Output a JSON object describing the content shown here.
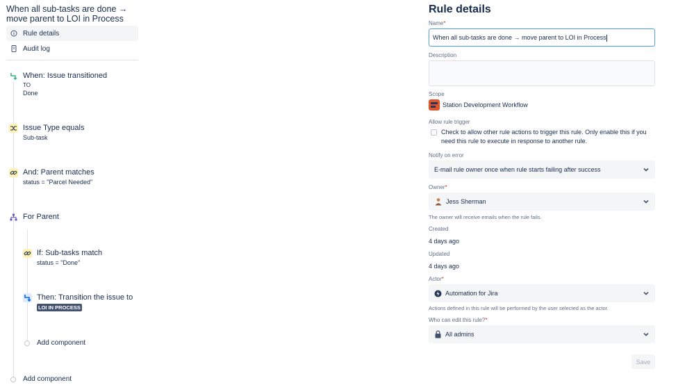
{
  "rule": {
    "title": "When all sub-tasks are done → move parent to LOI in Process"
  },
  "nav": {
    "items": [
      {
        "label": "Rule details",
        "icon": "info-icon"
      },
      {
        "label": "Audit log",
        "icon": "document-icon"
      }
    ]
  },
  "components": {
    "trigger": {
      "title": "When: Issue transitioned",
      "line1": "TO",
      "line2": "Done",
      "icon": "transition-icon",
      "color": "#36b37e"
    },
    "condition1": {
      "title": "Issue Type equals",
      "sub": "Sub-task",
      "icon": "shuffle-icon",
      "color": "#ffc400"
    },
    "condition2": {
      "title": "And: Parent matches",
      "sub": "status = \"Parcel Needed\"",
      "icon": "link-icon",
      "color": "#ffc400"
    },
    "branch": {
      "title": "For Parent",
      "icon": "branch-icon",
      "color": "#6554c0"
    },
    "branch_condition": {
      "title": "If: Sub-tasks match",
      "sub": "status = \"Done\"",
      "icon": "link-icon",
      "color": "#ffc400"
    },
    "action": {
      "title": "Then: Transition the issue to",
      "status_lozenge": "LOI IN PROCESS",
      "icon": "transition-icon",
      "color": "#0065ff"
    },
    "add_inner": "Add component",
    "add_outer": "Add component"
  },
  "details": {
    "heading": "Rule details",
    "name_label": "Name",
    "name_value": "When all sub-tasks are done → move parent to LOI in Process",
    "description_label": "Description",
    "description_value": "",
    "scope_label": "Scope",
    "scope_value": "Station Development Workflow",
    "allow_trigger_label": "Allow rule trigger",
    "allow_trigger_text": "Check to allow other rule actions to trigger this rule. Only enable this if you need this rule to execute in response to another rule.",
    "allow_trigger_checked": false,
    "notify_label": "Notify on error",
    "notify_value": "E-mail rule owner once when rule starts failing after success",
    "owner_label": "Owner",
    "owner_value": "Jess Sherman",
    "owner_help": "The owner will receive emails when the rule fails.",
    "created_label": "Created",
    "created_value": "4 days ago",
    "updated_label": "Updated",
    "updated_value": "4 days ago",
    "actor_label": "Actor",
    "actor_value": "Automation for Jira",
    "actor_help": "Actions defined in this rule will be performed by the user selected as the actor.",
    "editors_label": "Who can edit this rule?",
    "editors_value": "All admins",
    "required_mark": "*",
    "save_label": "Save"
  },
  "colors": {
    "accent": "#4c9aff",
    "required": "#de350b",
    "lozenge_bg": "#42526e"
  }
}
